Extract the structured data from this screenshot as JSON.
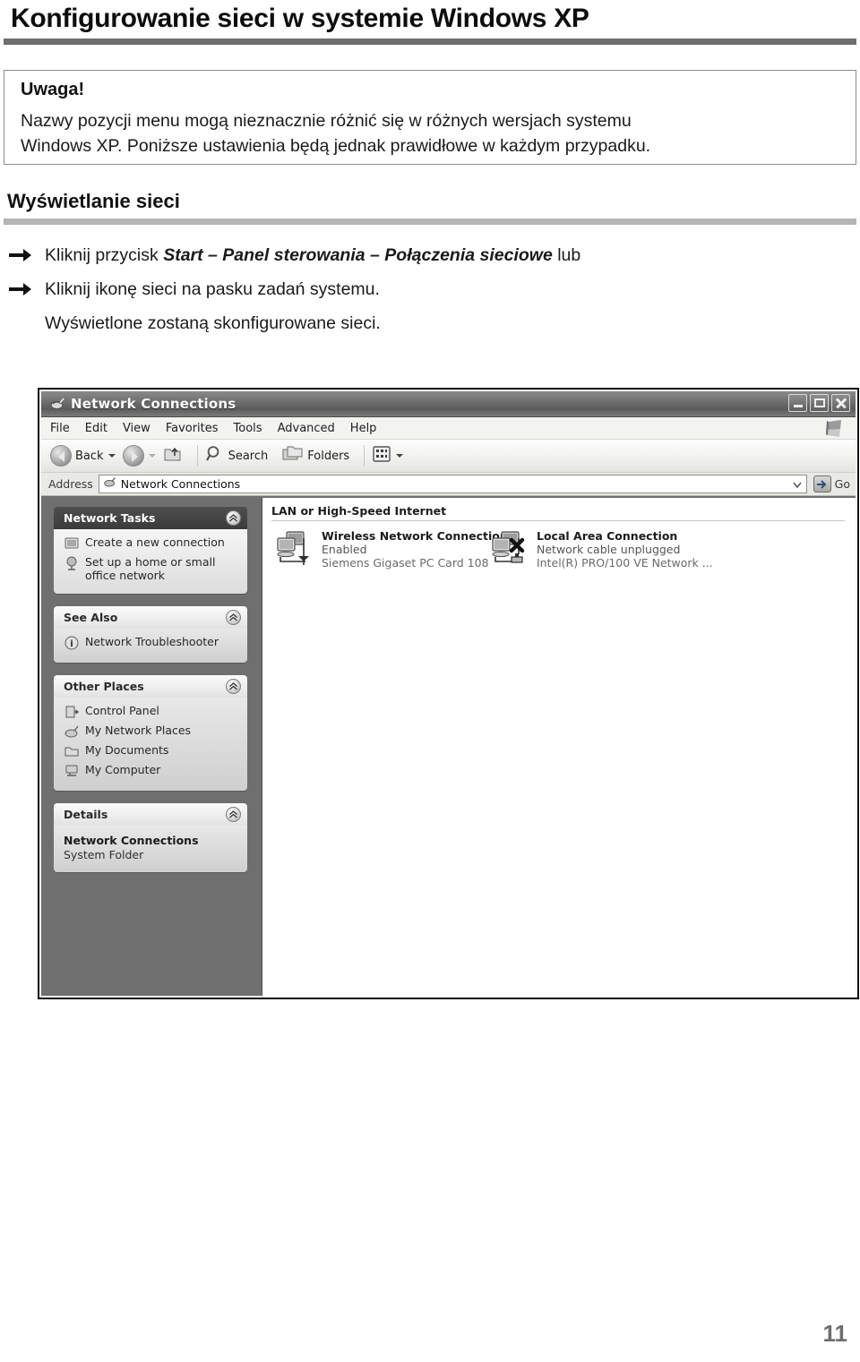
{
  "document": {
    "title": "Konfigurowanie sieci w systemie Windows XP",
    "page_number": "11"
  },
  "note": {
    "heading": "Uwaga!",
    "line1": "Nazwy pozycji menu mogą nieznacznie różnić się w różnych wersjach systemu",
    "line2": "Windows XP. Poniższe ustawienia będą jednak prawidłowe w każdym przypadku."
  },
  "section": {
    "heading": "Wyświetlanie sieci"
  },
  "steps": [
    {
      "icon": "arrow-right-icon",
      "prefix": "Kliknij przycisk ",
      "emphasis": "Start – Panel sterowania – Połączenia sieciowe",
      "suffix": " lub"
    },
    {
      "icon": "arrow-right-icon",
      "prefix": "Kliknij ikonę sieci na pasku zadań systemu.",
      "emphasis": "",
      "suffix": ""
    }
  ],
  "step_note": "Wyświetlone zostaną skonfigurowane sieci.",
  "screenshot": {
    "window": {
      "title": "Network Connections",
      "title_icon": "network-connections-icon",
      "buttons": {
        "minimize": "minimize-icon",
        "maximize": "maximize-icon",
        "close": "close-icon"
      }
    },
    "menubar": [
      "File",
      "Edit",
      "View",
      "Favorites",
      "Tools",
      "Advanced",
      "Help"
    ],
    "toolbar": {
      "back": "Back",
      "search": "Search",
      "folders": "Folders"
    },
    "address": {
      "label": "Address",
      "value": "Network Connections",
      "go": "Go"
    },
    "sidebar": [
      {
        "title": "Network Tasks",
        "style": "dark",
        "items": [
          {
            "icon": "new-connection-icon",
            "label": "Create a new connection"
          },
          {
            "icon": "home-network-icon",
            "label": "Set up a home or small\noffice network"
          }
        ]
      },
      {
        "title": "See Also",
        "style": "light",
        "items": [
          {
            "icon": "info-icon",
            "label": "Network Troubleshooter"
          }
        ]
      },
      {
        "title": "Other Places",
        "style": "light",
        "items": [
          {
            "icon": "control-panel-icon",
            "label": "Control Panel"
          },
          {
            "icon": "my-network-places-icon",
            "label": "My Network Places"
          },
          {
            "icon": "my-documents-icon",
            "label": "My Documents"
          },
          {
            "icon": "my-computer-icon",
            "label": "My Computer"
          }
        ]
      },
      {
        "title": "Details",
        "style": "light",
        "details": {
          "name": "Network Connections",
          "type": "System Folder"
        }
      }
    ],
    "content": {
      "group_header": "LAN or High-Speed Internet",
      "connections": [
        {
          "icon": "wireless-connection-icon",
          "name": "Wireless Network Connection",
          "status": "Enabled",
          "device": "Siemens Gigaset PC Card 108"
        },
        {
          "icon": "lan-connection-unplugged-icon",
          "name": "Local Area Connection",
          "status": "Network cable unplugged",
          "device": "Intel(R) PRO/100 VE Network ..."
        }
      ]
    }
  }
}
